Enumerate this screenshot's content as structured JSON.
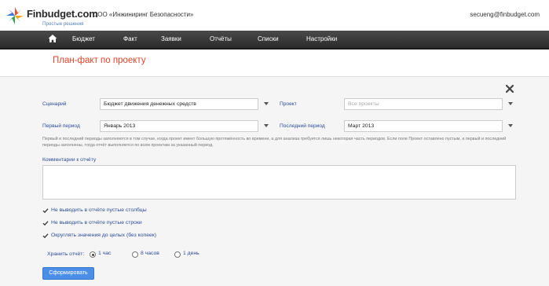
{
  "header": {
    "logo_text": "Finbudget.com",
    "logo_subtitle": "Простые решения",
    "organization": "ООО «Инжиниринг Безопасности»",
    "user_email": "secueng@finbudget.com"
  },
  "nav": {
    "items": [
      "Бюджет",
      "Факт",
      "Заявки",
      "Отчёты",
      "Списки",
      "Настройки"
    ]
  },
  "page": {
    "title": "План-факт по проекту"
  },
  "form": {
    "scenario_label": "Сценарий",
    "scenario_value": "Бюджет движения денежных средств",
    "project_label": "Проект",
    "project_placeholder": "Все проекты",
    "first_period_label": "Первый период",
    "first_period_value": "Январь 2013",
    "last_period_label": "Последний период",
    "last_period_value": "Март 2013",
    "hint": "Первый и последний периоды заполняются в том случае, когда проект имеет большую протяжённость во времени, а для анализа требуется лишь некоторая часть периодов. Если поле Проект оставлено пустым, а первый и последний периоды заполнены, тогда отчёт выполняется по всем проектам за указанный период.",
    "comments_label": "Комментарии к отчёту",
    "checkboxes": [
      "Не выводить в отчёте пустые столбцы",
      "Не выводить в отчёте пустые строки",
      "Округлять значения до целых (без копеек)"
    ],
    "store_label": "Хранить отчёт:",
    "store_options": [
      "1 час",
      "8 часов",
      "1 день"
    ],
    "submit_label": "Сформировать"
  },
  "colors": {
    "title_red": "#e4432d",
    "label_blue": "#2b4b9b",
    "button_blue": "#4a8ee8",
    "nav_dark": "#2b2b2b"
  }
}
